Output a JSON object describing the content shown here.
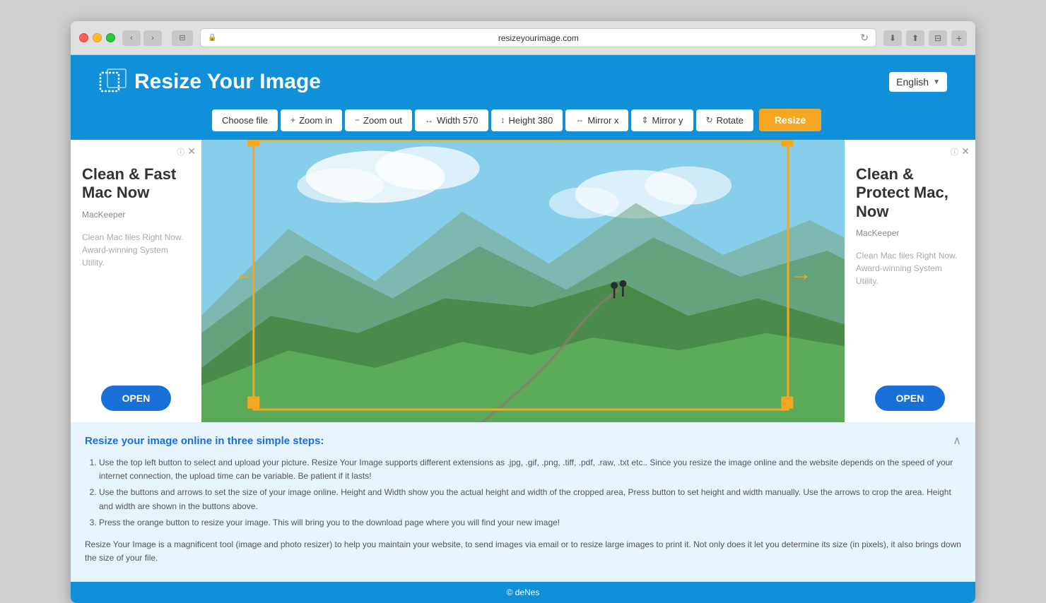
{
  "browser": {
    "url": "resizeyourimage.com",
    "reload_icon": "↻"
  },
  "header": {
    "title": "Resize Your Image",
    "lang_label": "English"
  },
  "toolbar": {
    "choose_label": "Choose file",
    "zoom_in_label": "Zoom in",
    "zoom_out_label": "Zoom out",
    "width_label": "Width 570",
    "height_label": "Height 380",
    "mirror_x_label": "Mirror x",
    "mirror_y_label": "Mirror y",
    "rotate_label": "Rotate",
    "resize_label": "Resize"
  },
  "ad_left": {
    "title": "Clean & Fast Mac Now",
    "brand": "MacKeeper",
    "body": "Clean Mac files Right Now. Award-winning System Utility.",
    "open_label": "OPEN"
  },
  "ad_right": {
    "title": "Clean & Protect Mac, Now",
    "brand": "MacKeeper",
    "body": "Clean Mac files Right Now. Award-winning System Utility.",
    "open_label": "OPEN"
  },
  "steps": {
    "heading": "Resize your image online in three simple steps:",
    "step1": "Use the top left button to select and upload your picture. Resize Your Image supports different extensions as .jpg, .gif, .png, .tiff, .pdf, .raw, .txt etc.. Since you resize the image online and the website depends on the speed of your internet connection, the upload time can be variable. Be patient if it lasts!",
    "step2": "Use the buttons and arrows to set the size of your image online. Height and Width show you the actual height and width of the cropped area, Press button to set height and width manually. Use the arrows to crop the area. Height and width are shown in the buttons above.",
    "step3": "Press the orange button to resize your image. This will bring you to the download page where you will find your new image!"
  },
  "footer_text": "Resize Your Image is a magnificent tool (image and photo resizer) to help you maintain your website, to send images via email or to resize large images to print it. Not only does it let you determine its size (in pixels), it also brings down the size of your file.",
  "copyright": "© deNes"
}
